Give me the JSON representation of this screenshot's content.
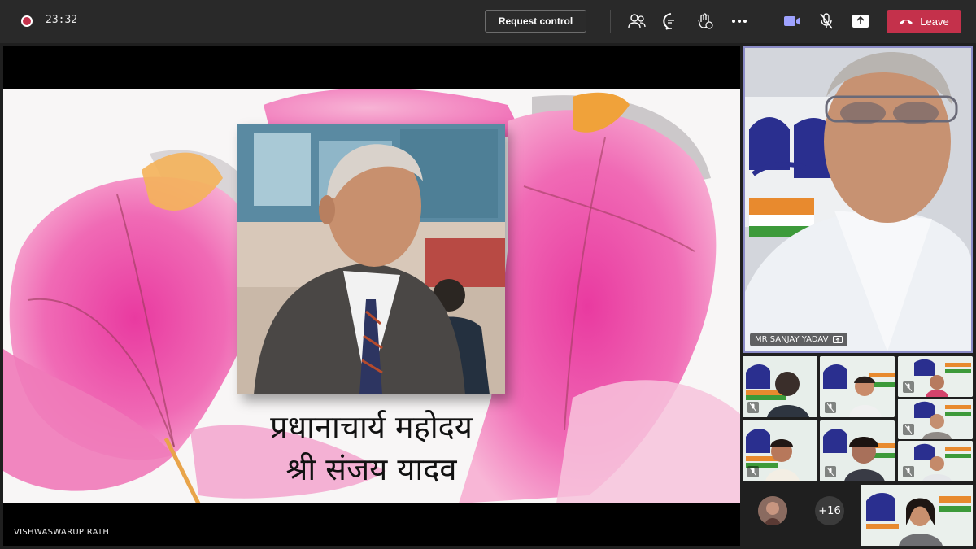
{
  "meeting": {
    "timer": "23:32",
    "request_control_label": "Request control",
    "leave_label": "Leave",
    "colors": {
      "leave": "#c4314b",
      "accent": "#8b8cc7",
      "recording": "#c4314b"
    }
  },
  "toolbar_icons": [
    "people-icon",
    "chat-icon",
    "react-icon",
    "more-icon",
    "camera-icon",
    "mic-off-icon",
    "share-icon",
    "phone-icon"
  ],
  "presenter": {
    "name": "VISHWASWARUP RATH",
    "slide": {
      "caption_line1": "प्रधानाचार्य महोदय",
      "caption_line2": "श्री संजय यादव"
    }
  },
  "spotlight": {
    "name": "MR SANJAY YADAV"
  },
  "gallery": {
    "overflow_count": "+16"
  }
}
